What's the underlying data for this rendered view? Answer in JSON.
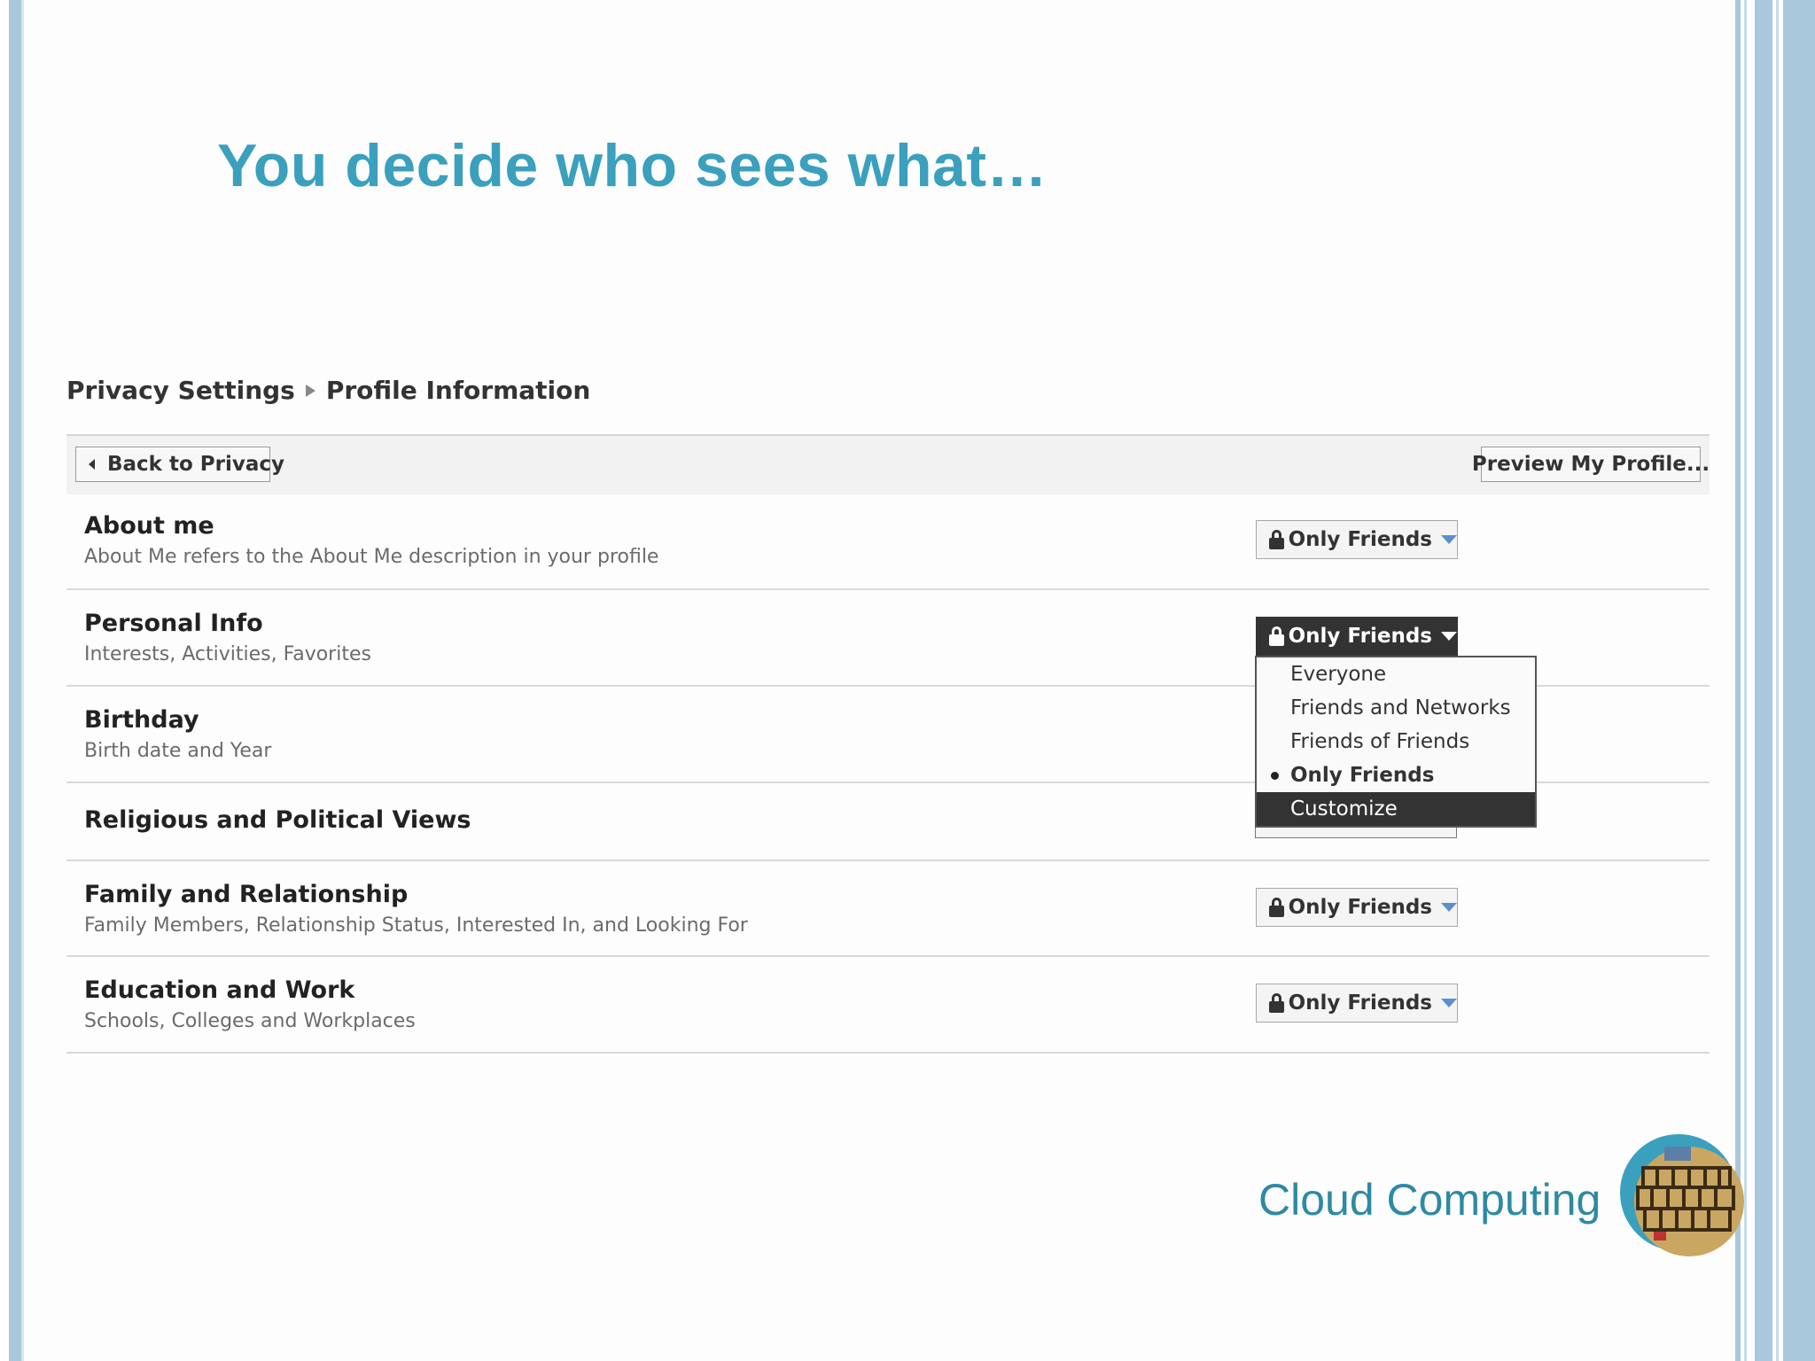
{
  "slide": {
    "title": "You decide who sees what…",
    "footer": "Cloud Computing"
  },
  "breadcrumb": {
    "root": "Privacy Settings",
    "current": "Profile Information"
  },
  "toolbar": {
    "back_label": "Back to Privacy",
    "preview_label": "Preview My Profile..."
  },
  "rows": [
    {
      "name": "About me",
      "desc": "About Me refers to the About Me description in your profile",
      "setting": "Only Friends"
    },
    {
      "name": "Personal Info",
      "desc": "Interests, Activities, Favorites",
      "setting": "Only Friends"
    },
    {
      "name": "Birthday",
      "desc": "Birth date and Year"
    },
    {
      "name": "Religious and Political Views"
    },
    {
      "name": "Family and Relationship",
      "desc": "Family Members, Relationship Status, Interested In, and Looking For",
      "setting": "Only Friends"
    },
    {
      "name": "Education and Work",
      "desc": "Schools, Colleges and Workplaces",
      "setting": "Only Friends"
    }
  ],
  "dropdown_menu": {
    "options": [
      "Everyone",
      "Friends and Networks",
      "Friends of Friends",
      "Only Friends",
      "Customize"
    ],
    "selected": "Only Friends",
    "highlighted": "Customize"
  },
  "colors": {
    "title": "#3aa0bd",
    "footer": "#2d8aa3",
    "open_select": "#333333",
    "caret": "#5a8fd0",
    "slide_border": "#a9c8db"
  },
  "icons": [
    "lock-icon",
    "caret-down-icon",
    "back-arrow-icon",
    "breadcrumb-arrow-icon",
    "cloud-computing-logo"
  ]
}
